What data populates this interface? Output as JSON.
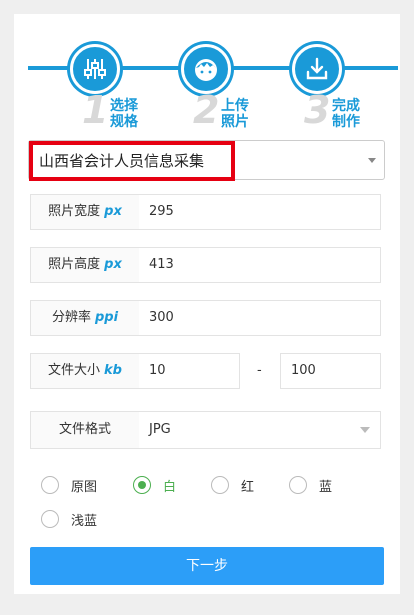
{
  "steps": [
    {
      "number": "1",
      "label": "选择\n规格",
      "icon": "sliders-icon"
    },
    {
      "number": "2",
      "label": "上传\n照片",
      "icon": "face-icon"
    },
    {
      "number": "3",
      "label": "完成\n制作",
      "icon": "download-icon"
    }
  ],
  "spec_select": {
    "value": "山西省会计人员信息采集"
  },
  "fields": {
    "width": {
      "label": "照片宽度",
      "unit": "px",
      "value": "295"
    },
    "height": {
      "label": "照片高度",
      "unit": "px",
      "value": "413"
    },
    "resolution": {
      "label": "分辨率",
      "unit": "ppi",
      "value": "300"
    },
    "filesize": {
      "label": "文件大小",
      "unit": "kb",
      "min": "10",
      "dash": "-",
      "max": "100"
    },
    "format": {
      "label": "文件格式",
      "value": "JPG"
    }
  },
  "background_options": [
    {
      "label": "原图",
      "selected": false
    },
    {
      "label": "白",
      "selected": true
    },
    {
      "label": "红",
      "selected": false
    },
    {
      "label": "蓝",
      "selected": false
    },
    {
      "label": "浅蓝",
      "selected": false
    }
  ],
  "next_button": "下一步",
  "colors": {
    "accent": "#1a9ad8",
    "button": "#2c9ef8",
    "highlight": "#e60012",
    "selected": "#4caf50"
  }
}
